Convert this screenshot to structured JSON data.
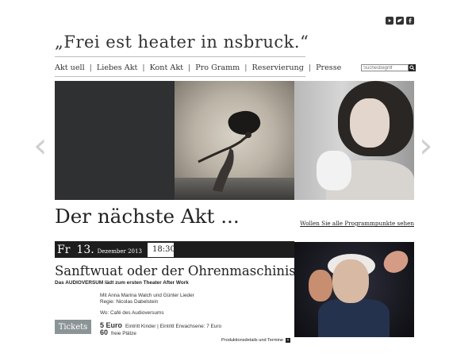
{
  "header": {
    "title": "„Frei est heater in nsbruck.“",
    "social": [
      "youtube-icon",
      "twitter-icon",
      "facebook-icon"
    ]
  },
  "nav": {
    "items": [
      "Akt uell",
      "Liebes Akt",
      "Kont Akt",
      "Pro Gramm",
      "Reservierung",
      "Presse"
    ],
    "separator": "|"
  },
  "search": {
    "placeholder": "Suchesbegriff"
  },
  "slider": {
    "prev_label": "‹",
    "next_label": "›"
  },
  "section": {
    "heading": "Der nächste Akt ...",
    "all_link": "Wollen Sie alle Programmpunkte sehen"
  },
  "event": {
    "weekday": "Fr",
    "day": "13.",
    "month_year": "Dezember 2013",
    "time": "18:30",
    "title": "Sanftwuat oder der Ohrenmaschinist",
    "subtitle": "Das AUDIOVERSUM lädt zum ersten Theater After Work",
    "cast": "Mit Anna Marina Walch und Günter Lieder",
    "director": "Regie: Nicolas Dabelstein",
    "location": "Wo: Café des Audioversums",
    "tickets_label": "Tickets",
    "price_amount": "5 Euro",
    "price_text": "Eintritt Kinder  |  Eintritt Erwachsene: 7 Euro",
    "places_count": "60",
    "places_text": "freie Plätze",
    "details_link": "Produktionsdetails und Termine"
  },
  "colors": {
    "dark": "#1d1d1d",
    "tickets": "#8b9496",
    "slide_dark": "#2e3031"
  }
}
